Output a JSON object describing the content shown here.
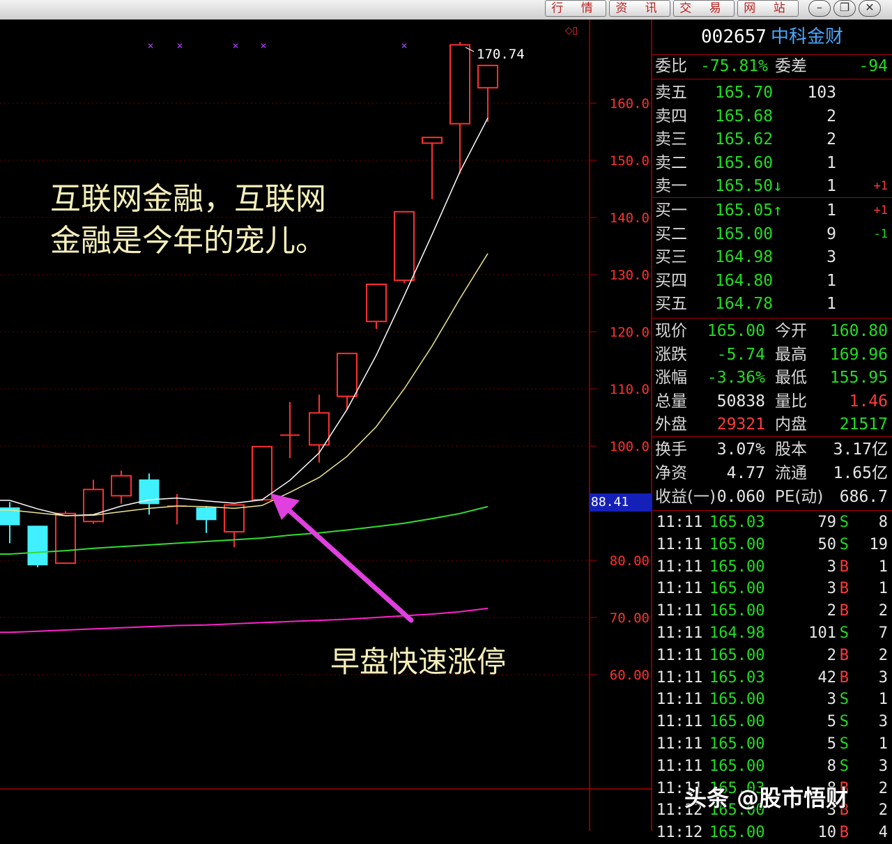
{
  "window": {
    "menu_buttons": [
      "行 情",
      "资 讯",
      "交 易",
      "网 站"
    ],
    "window_buttons": [
      "minimize-icon",
      "restore-icon",
      "close-icon"
    ]
  },
  "stock": {
    "code": "002657",
    "name": "中科金财"
  },
  "order_book": {
    "weibi_label": "委比",
    "weibi_value": "-75.81%",
    "weicha_label": "委差",
    "weicha_value": "-94",
    "sells": [
      {
        "label": "卖五",
        "price": "165.70",
        "vol": "103",
        "chg": ""
      },
      {
        "label": "卖四",
        "price": "165.68",
        "vol": "2",
        "chg": ""
      },
      {
        "label": "卖三",
        "price": "165.62",
        "vol": "2",
        "chg": ""
      },
      {
        "label": "卖二",
        "price": "165.60",
        "vol": "1",
        "chg": ""
      },
      {
        "label": "卖一",
        "price": "165.50↓",
        "vol": "1",
        "chg": "+1"
      }
    ],
    "buys": [
      {
        "label": "买一",
        "price": "165.05↑",
        "vol": "1",
        "chg": "+1"
      },
      {
        "label": "买二",
        "price": "165.00",
        "vol": "9",
        "chg": "-1"
      },
      {
        "label": "买三",
        "price": "164.98",
        "vol": "3",
        "chg": ""
      },
      {
        "label": "买四",
        "price": "164.80",
        "vol": "1",
        "chg": ""
      },
      {
        "label": "买五",
        "price": "164.78",
        "vol": "1",
        "chg": ""
      }
    ]
  },
  "quote": [
    {
      "l1": "现价",
      "v1": "165.00",
      "l2": "今开",
      "v2": "160.80"
    },
    {
      "l1": "涨跌",
      "v1": "-5.74",
      "l2": "最高",
      "v2": "169.96"
    },
    {
      "l1": "涨幅",
      "v1": "-3.36%",
      "l2": "最低",
      "v2": "155.95"
    },
    {
      "l1": "总量",
      "v1": "50838",
      "l2": "量比",
      "v2": "1.46"
    },
    {
      "l1": "外盘",
      "v1": "29321",
      "l2": "内盘",
      "v2": "21517"
    }
  ],
  "fundamentals": [
    {
      "l1": "换手",
      "v1": "3.07%",
      "l2": "股本",
      "v2": "3.17亿"
    },
    {
      "l1": "净资",
      "v1": "4.77",
      "l2": "流通",
      "v2": "1.65亿"
    },
    {
      "l1": "收益(一)",
      "v1": "0.060",
      "l2": "PE(动)",
      "v2": "686.7"
    }
  ],
  "ticks": [
    {
      "time": "11:11",
      "price": "165.03",
      "vol": "79",
      "side": "S",
      "count": "8"
    },
    {
      "time": "11:11",
      "price": "165.00",
      "vol": "50",
      "side": "S",
      "count": "19"
    },
    {
      "time": "11:11",
      "price": "165.00",
      "vol": "3",
      "side": "B",
      "count": "1"
    },
    {
      "time": "11:11",
      "price": "165.00",
      "vol": "3",
      "side": "B",
      "count": "1"
    },
    {
      "time": "11:11",
      "price": "165.00",
      "vol": "2",
      "side": "B",
      "count": "2"
    },
    {
      "time": "11:11",
      "price": "164.98",
      "vol": "101",
      "side": "S",
      "count": "7"
    },
    {
      "time": "11:11",
      "price": "165.00",
      "vol": "2",
      "side": "B",
      "count": "2"
    },
    {
      "time": "11:11",
      "price": "165.03",
      "vol": "42",
      "side": "B",
      "count": "3"
    },
    {
      "time": "11:11",
      "price": "165.00",
      "vol": "3",
      "side": "S",
      "count": "1"
    },
    {
      "time": "11:11",
      "price": "165.00",
      "vol": "5",
      "side": "S",
      "count": "3"
    },
    {
      "time": "11:11",
      "price": "165.00",
      "vol": "5",
      "side": "S",
      "count": "1"
    },
    {
      "time": "11:11",
      "price": "165.00",
      "vol": "8",
      "side": "S",
      "count": "3"
    },
    {
      "time": "11:11",
      "price": "165.03",
      "vol": "8",
      "side": "B",
      "count": "2"
    },
    {
      "time": "11:12",
      "price": "165.00",
      "vol": "3",
      "side": "B",
      "count": "2"
    },
    {
      "time": "11:12",
      "price": "165.00",
      "vol": "10",
      "side": "B",
      "count": "4"
    }
  ],
  "annotations": {
    "text1_line1": "互联网金融，互联网",
    "text1_line2": "金融是今年的宠儿。",
    "text2": "早盘快速涨停"
  },
  "watermark": "头条 @股市悟财",
  "current_price_marker": "88.41",
  "colors": {
    "up": "#ff2020",
    "down": "#40f0ff",
    "ma_short": "#ffffff",
    "ma_mid": "#f0e68c",
    "ma_long": "#33dd33",
    "ma_vlong": "#ff22cc",
    "arrow": "#e040e0",
    "grid": "#b00000"
  },
  "chart_data": {
    "type": "candlestick",
    "ylim": [
      55,
      175
    ],
    "y_ticks": [
      "160.0",
      "150.0",
      "140.0",
      "130.0",
      "120.0",
      "110.0",
      "100.0",
      "80.00",
      "70.00",
      "60.00"
    ],
    "high_label": "170.74",
    "candles": [
      {
        "open": 89.2,
        "close": 86.2,
        "high": 90.2,
        "low": 83.0
      },
      {
        "open": 86.0,
        "close": 79.2,
        "high": 86.0,
        "low": 78.8
      },
      {
        "open": 79.5,
        "close": 88.2,
        "high": 88.6,
        "low": 79.5
      },
      {
        "open": 86.8,
        "close": 92.4,
        "high": 94.1,
        "low": 86.4
      },
      {
        "open": 91.3,
        "close": 94.8,
        "high": 95.7,
        "low": 89.9
      },
      {
        "open": 94.1,
        "close": 89.9,
        "high": 95.2,
        "low": 88.0
      },
      {
        "open": 89.5,
        "close": 89.5,
        "high": 91.6,
        "low": 86.3
      },
      {
        "open": 89.2,
        "close": 87.1,
        "high": 89.5,
        "low": 84.8
      },
      {
        "open": 85.0,
        "close": 89.7,
        "high": 89.7,
        "low": 82.3
      },
      {
        "open": 90.6,
        "close": 99.9,
        "high": 100.0,
        "low": 90.4
      },
      {
        "open": 101.9,
        "close": 101.9,
        "high": 107.7,
        "low": 97.9
      },
      {
        "open": 100.2,
        "close": 105.8,
        "high": 109.0,
        "low": 97.1
      },
      {
        "open": 108.7,
        "close": 116.2,
        "high": 116.2,
        "low": 106.3
      },
      {
        "open": 121.8,
        "close": 128.3,
        "high": 128.3,
        "low": 120.5
      },
      {
        "open": 129.0,
        "close": 141.0,
        "high": 141.0,
        "low": 128.5
      },
      {
        "open": 153.0,
        "close": 154.0,
        "high": 154.0,
        "low": 143.2
      },
      {
        "open": 156.4,
        "close": 170.2,
        "high": 170.7,
        "low": 147.7
      },
      {
        "open": 162.7,
        "close": 166.6,
        "high": 166.6,
        "low": 156.7
      }
    ],
    "series": [
      {
        "values": [
          90.5,
          89.0,
          87.8,
          88.0,
          89.5,
          90.6,
          90.9,
          90.4,
          90.0,
          90.6,
          94.0,
          98.8,
          106.4,
          115.9,
          126.3,
          137.0,
          148.0,
          157.4
        ]
      },
      {
        "values": [
          88.8,
          88.3,
          87.8,
          87.9,
          88.5,
          89.1,
          89.5,
          89.4,
          89.1,
          89.6,
          91.9,
          94.5,
          98.2,
          103.4,
          110.0,
          117.5,
          125.8,
          133.7
        ]
      },
      {
        "values": [
          81.1,
          81.4,
          81.7,
          82.1,
          82.4,
          82.7,
          83.0,
          83.3,
          83.6,
          83.9,
          84.4,
          84.8,
          85.3,
          85.9,
          86.5,
          87.3,
          88.2,
          89.4
        ]
      },
      {
        "values": [
          67.4,
          67.6,
          67.8,
          68.0,
          68.2,
          68.4,
          68.6,
          68.7,
          68.9,
          69.1,
          69.3,
          69.5,
          69.7,
          70.0,
          70.3,
          70.6,
          71.0,
          71.6
        ]
      }
    ]
  }
}
